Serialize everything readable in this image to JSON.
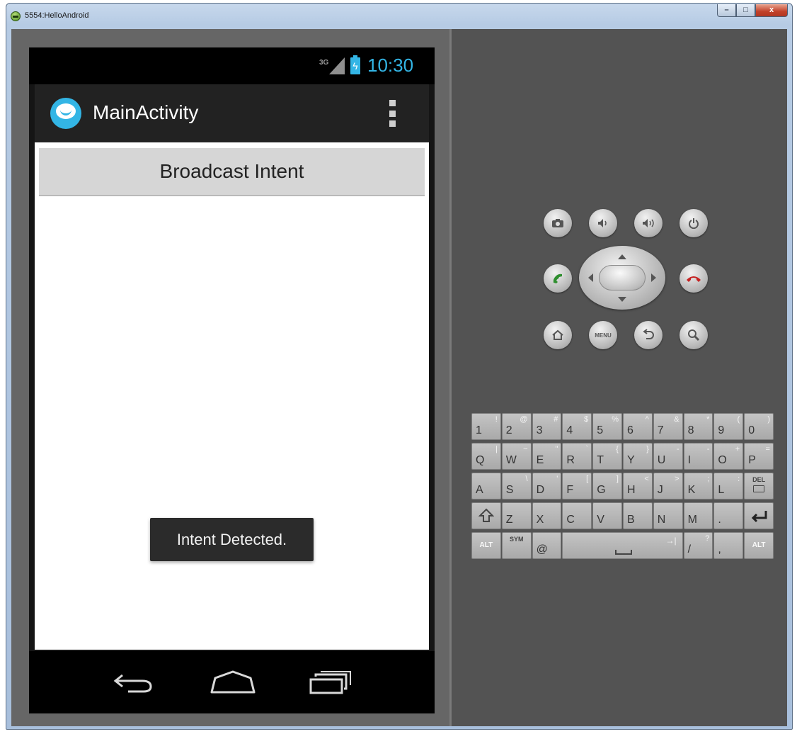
{
  "window": {
    "title": "5554:HelloAndroid",
    "controls": {
      "minimize": "–",
      "maximize": "□",
      "close": "x"
    }
  },
  "statusbar": {
    "network": "3G",
    "battery_icon": "battery-charging-icon",
    "time": "10:30"
  },
  "actionbar": {
    "title": "MainActivity",
    "app_icon": "app-logo-icon",
    "overflow_icon": "overflow-menu-icon"
  },
  "content": {
    "button_label": "Broadcast Intent"
  },
  "toast": {
    "text": "Intent Detected."
  },
  "navbar": {
    "back": "back-icon",
    "home": "home-icon",
    "recents": "recents-icon"
  },
  "hardware": {
    "row1": [
      "camera-icon",
      "volume-down-icon",
      "volume-up-icon",
      "power-icon"
    ],
    "call": "call-icon",
    "end_call": "end-call-icon",
    "row3": [
      "home-icon",
      "menu-icon",
      "back-icon",
      "search-icon"
    ],
    "menu_label": "MENU"
  },
  "keyboard": {
    "row1": [
      {
        "main": "1",
        "shift": "!"
      },
      {
        "main": "2",
        "shift": "@"
      },
      {
        "main": "3",
        "shift": "#"
      },
      {
        "main": "4",
        "shift": "$"
      },
      {
        "main": "5",
        "shift": "%"
      },
      {
        "main": "6",
        "shift": "^"
      },
      {
        "main": "7",
        "shift": "&"
      },
      {
        "main": "8",
        "shift": "*"
      },
      {
        "main": "9",
        "shift": "("
      },
      {
        "main": "0",
        "shift": ")"
      }
    ],
    "row2": [
      {
        "main": "Q",
        "shift": "|"
      },
      {
        "main": "W",
        "shift": "~"
      },
      {
        "main": "E",
        "shift": "\""
      },
      {
        "main": "R",
        "shift": "`"
      },
      {
        "main": "T",
        "shift": "{"
      },
      {
        "main": "Y",
        "shift": "}"
      },
      {
        "main": "U",
        "shift": "-"
      },
      {
        "main": "I",
        "shift": "-"
      },
      {
        "main": "O",
        "shift": "+"
      },
      {
        "main": "P",
        "shift": "="
      }
    ],
    "row3": [
      {
        "main": "A",
        "shift": ""
      },
      {
        "main": "S",
        "shift": "\\"
      },
      {
        "main": "D",
        "shift": "'"
      },
      {
        "main": "F",
        "shift": "["
      },
      {
        "main": "G",
        "shift": "]"
      },
      {
        "main": "H",
        "shift": "<"
      },
      {
        "main": "J",
        "shift": ">"
      },
      {
        "main": "K",
        "shift": ";"
      },
      {
        "main": "L",
        "shift": ":"
      }
    ],
    "row3_del": "DEL",
    "row4": [
      {
        "main": "Z",
        "shift": ""
      },
      {
        "main": "X",
        "shift": ""
      },
      {
        "main": "C",
        "shift": ""
      },
      {
        "main": "V",
        "shift": ""
      },
      {
        "main": "B",
        "shift": ""
      },
      {
        "main": "N",
        "shift": ""
      },
      {
        "main": "M",
        "shift": ""
      },
      {
        "main": ".",
        "shift": ""
      }
    ],
    "alt_left": "ALT",
    "sym": "SYM",
    "at": "@",
    "slash": {
      "main": "/",
      "shift": "?"
    },
    "comma": {
      "main": ",",
      "shift": ""
    },
    "alt_right": "ALT"
  }
}
